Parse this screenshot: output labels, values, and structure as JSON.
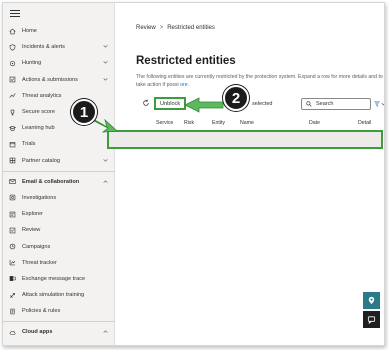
{
  "sidebar": {
    "items": [
      {
        "label": "Home",
        "icon": "home-icon",
        "chevron": false
      },
      {
        "label": "Incidents & alerts",
        "icon": "shield-alert-icon",
        "chevron": true
      },
      {
        "label": "Hunting",
        "icon": "hunting-icon",
        "chevron": true
      },
      {
        "label": "Actions & submissions",
        "icon": "actions-icon",
        "chevron": true
      },
      {
        "label": "Threat analytics",
        "icon": "threat-analytics-icon",
        "chevron": false
      },
      {
        "label": "Secure score",
        "icon": "trophy-icon",
        "chevron": false
      },
      {
        "label": "Learning hub",
        "icon": "learning-icon",
        "chevron": false
      },
      {
        "label": "Trials",
        "icon": "trials-icon",
        "chevron": false
      },
      {
        "label": "Partner catalog",
        "icon": "partner-icon",
        "chevron": true
      }
    ],
    "email_section": {
      "label": "Email & collaboration",
      "icon": "mail-icon"
    },
    "email_items": [
      {
        "label": "Investigations",
        "icon": "investigations-icon"
      },
      {
        "label": "Explorer",
        "icon": "explorer-icon"
      },
      {
        "label": "Review",
        "icon": "review-icon"
      },
      {
        "label": "Campaigns",
        "icon": "campaigns-icon"
      },
      {
        "label": "Threat tracker",
        "icon": "threat-tracker-icon"
      },
      {
        "label": "Exchange message trace",
        "icon": "exchange-icon"
      },
      {
        "label": "Attack simulation training",
        "icon": "attack-sim-icon"
      },
      {
        "label": "Policies & rules",
        "icon": "policies-icon"
      }
    ],
    "cloud_section": {
      "label": "Cloud apps",
      "icon": "cloud-icon"
    }
  },
  "breadcrumb": {
    "parent": "Review",
    "separator": ">",
    "current": "Restricted entities"
  },
  "page": {
    "title": "Restricted entities",
    "description_part1": "The following entities are currently restricted by the protection system. Expand a row for more details and to take action if possi",
    "description_link": "ore."
  },
  "toolbar": {
    "unblock_label": "Unblock",
    "selected_text": "selected",
    "search_placeholder": "Search"
  },
  "table": {
    "headers": [
      "Service",
      "Risk",
      "Entity",
      "Name",
      "Date",
      "Detail"
    ]
  },
  "annotations": {
    "badge1": "1",
    "badge2": "2"
  },
  "colors": {
    "highlight_green": "#3f9b3f",
    "badge_black": "#1b1b1b",
    "teal_button": "#2b7a87",
    "dark_button": "#1f1f1f",
    "link_blue": "#0078d4"
  }
}
